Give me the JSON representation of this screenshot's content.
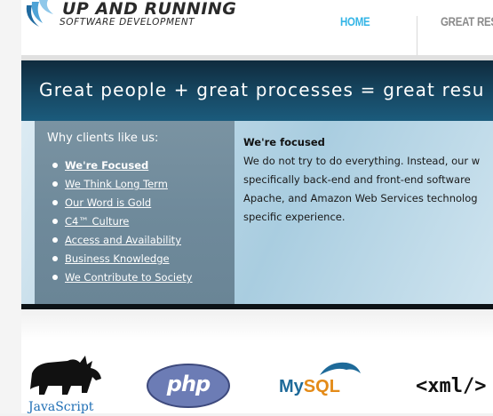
{
  "header": {
    "logo_title": "UP AND RUNNING",
    "logo_subtitle": "SOFTWARE DEVELOPMENT",
    "nav": [
      {
        "label": "HOME",
        "active": true
      },
      {
        "label": "GREAT RES",
        "active": false
      }
    ]
  },
  "banner": {
    "slogan": "Great people  +  great processes  =  great resu"
  },
  "sidebar": {
    "heading": "Why clients like us:",
    "items": [
      {
        "label": "We're Focused",
        "active": true
      },
      {
        "label": "We Think Long Term",
        "active": false
      },
      {
        "label": "Our Word is Gold",
        "active": false
      },
      {
        "label": "C4™ Culture",
        "active": false
      },
      {
        "label": "Access and Availability",
        "active": false
      },
      {
        "label": "Business Knowledge",
        "active": false
      },
      {
        "label": "We Contribute to Society",
        "active": false
      }
    ]
  },
  "main": {
    "heading": "We're focused",
    "lines": [
      "We do not try to do everything. Instead, our w",
      "specifically back-end and front-end software",
      "Apache, and Amazon Web Services technolog",
      "specific experience."
    ]
  },
  "technologies": {
    "javascript": "JavaScript",
    "php": "php",
    "mysql_my": "My",
    "mysql_sql": "SQL",
    "xml": "<xml/>"
  },
  "colors": {
    "nav_active": "#34b5e6",
    "nav_inactive": "#8a8a8a",
    "banner_dark": "#0f2b3d",
    "sidebar_bg": "#7a93a2"
  }
}
